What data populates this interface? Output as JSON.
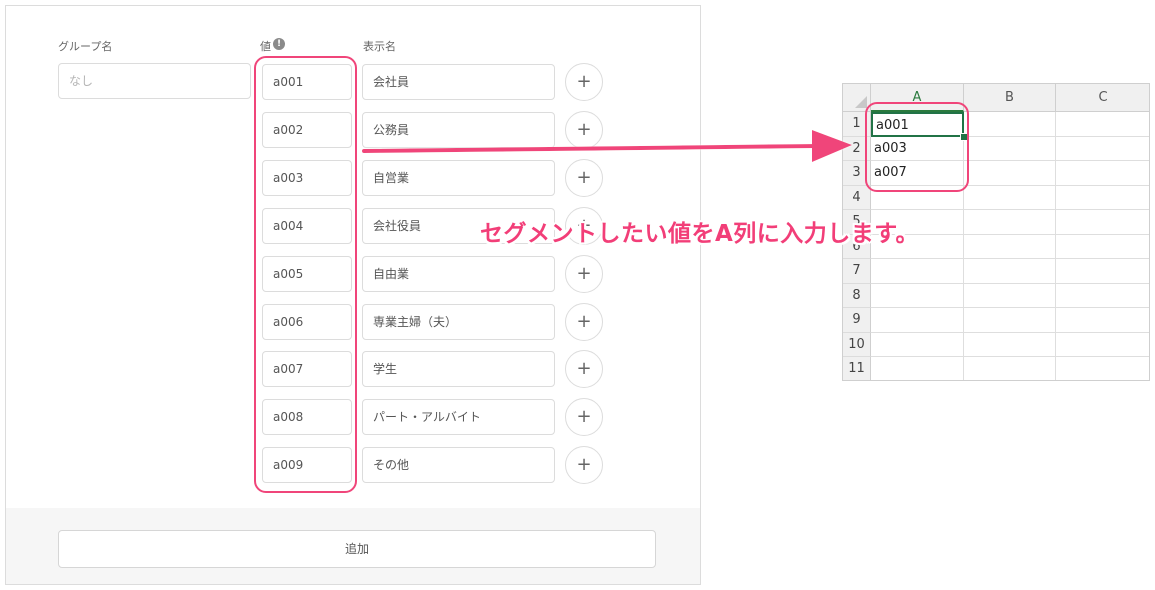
{
  "form": {
    "labels": {
      "group_name": "グループ名",
      "value": "値",
      "display_name": "表示名"
    },
    "info_glyph": "!",
    "group_name_placeholder": "なし",
    "rows": [
      {
        "value": "a001",
        "display": "会社員"
      },
      {
        "value": "a002",
        "display": "公務員"
      },
      {
        "value": "a003",
        "display": "自営業"
      },
      {
        "value": "a004",
        "display": "会社役員"
      },
      {
        "value": "a005",
        "display": "自由業"
      },
      {
        "value": "a006",
        "display": "専業主婦（夫）"
      },
      {
        "value": "a007",
        "display": "学生"
      },
      {
        "value": "a008",
        "display": "パート・アルバイト"
      },
      {
        "value": "a009",
        "display": "その他"
      }
    ],
    "plus_glyph": "+",
    "add_label": "追加"
  },
  "sheet": {
    "columns": [
      "A",
      "B",
      "C"
    ],
    "row_numbers": [
      "1",
      "2",
      "3",
      "4",
      "5",
      "6",
      "7",
      "8",
      "9",
      "10",
      "11"
    ],
    "col_a_values": [
      "a001",
      "a003",
      "a007"
    ]
  },
  "annotation": {
    "caption": "セグメントしたい値をA列に入力します。",
    "accent_color": "#f0457a"
  }
}
